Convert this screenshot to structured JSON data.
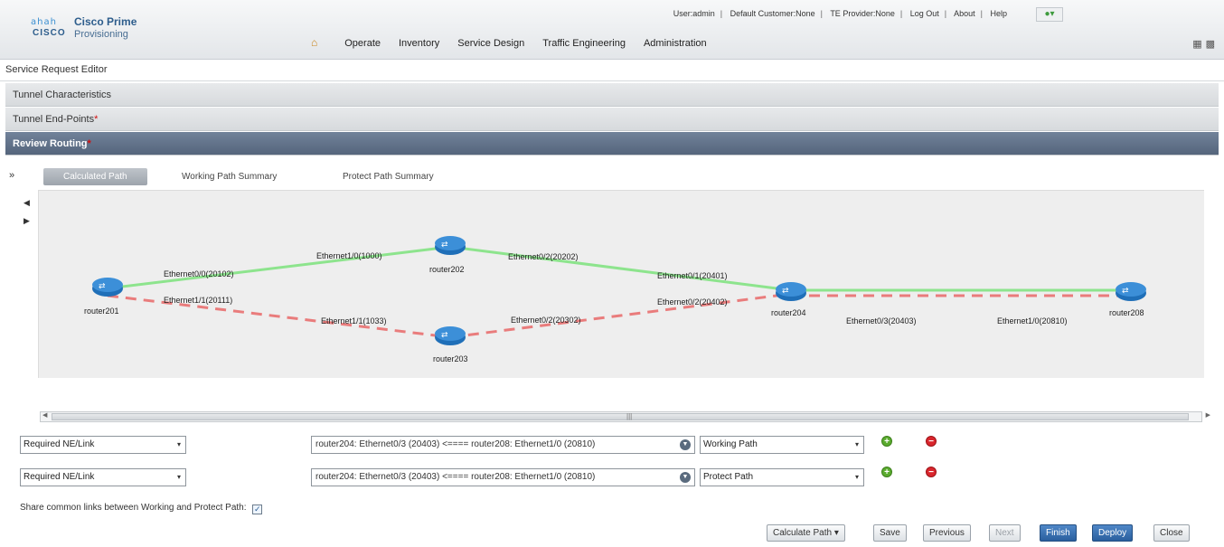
{
  "header": {
    "brand_bars": "ahah",
    "brand_cisco": "CISCO",
    "product_line1": "Cisco Prime",
    "product_line2": "Provisioning",
    "links": [
      "User:admin",
      "Default Customer:None",
      "TE Provider:None",
      "Log Out",
      "About",
      "Help"
    ],
    "nav": [
      "Operate",
      "Inventory",
      "Service Design",
      "Traffic Engineering",
      "Administration"
    ]
  },
  "editor": {
    "title": "Service Request Editor",
    "sections": [
      {
        "label": "Tunnel Characteristics",
        "required": false
      },
      {
        "label": "Tunnel End-Points",
        "required": true
      },
      {
        "label": "Review Routing",
        "required": true
      }
    ]
  },
  "tabs": [
    "Calculated Path",
    "Working Path Summary",
    "Protect Path Summary"
  ],
  "topology": {
    "colors": {
      "working": "#8de48d",
      "protect": "#e97c7c",
      "router": "#1f6fb8"
    },
    "routers": [
      "router201",
      "router202",
      "router203",
      "router204",
      "router208"
    ],
    "links": [
      {
        "from": "router201",
        "to": "router202",
        "path": "working",
        "from_label": "Ethernet0/0(20102)",
        "to_label": "Ethernet1/0(1000)"
      },
      {
        "from": "router202",
        "to": "router204",
        "path": "working",
        "from_label": "Ethernet0/2(20202)",
        "to_label": "Ethernet0/1(20401)"
      },
      {
        "from": "router201",
        "to": "router203",
        "path": "protect",
        "from_label": "Ethernet1/1(20111)",
        "to_label": "Ethernet1/1(1033)"
      },
      {
        "from": "router203",
        "to": "router204",
        "path": "protect",
        "from_label": "Ethernet0/2(20302)",
        "to_label": "Ethernet0/2(20402)"
      },
      {
        "from": "router204",
        "to": "router208",
        "path": "both",
        "from_label": "Ethernet0/3(20403)",
        "to_label": "Ethernet1/0(20810)"
      }
    ]
  },
  "constraints": [
    {
      "type": "Required NE/Link",
      "path_value": "router204: Ethernet0/3 (20403) <==== router208: Ethernet1/0 (20810)",
      "path_kind": "Working Path"
    },
    {
      "type": "Required NE/Link",
      "path_value": "router204: Ethernet0/3 (20403) <==== router208: Ethernet1/0 (20810)",
      "path_kind": "Protect Path"
    }
  ],
  "share_common_links_label": "Share common links between Working and Protect Path:",
  "share_common_links_checked": true,
  "buttons": {
    "calculate_path": "Calculate Path",
    "save": "Save",
    "previous": "Previous",
    "next": "Next",
    "finish": "Finish",
    "deploy": "Deploy",
    "close": "Close"
  }
}
